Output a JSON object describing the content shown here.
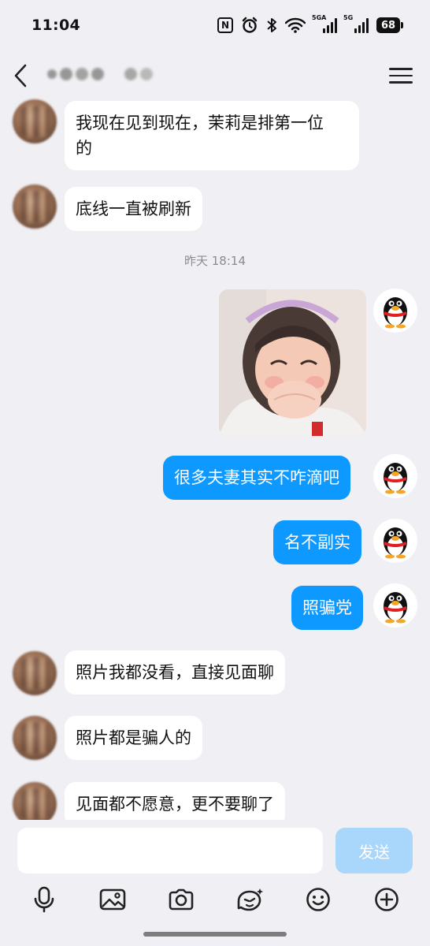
{
  "status_bar": {
    "time": "11:04",
    "battery": "68",
    "signal_1_label": "5GA",
    "signal_2_label": "5G",
    "nfc_label": "N"
  },
  "header": {
    "contact_name_hidden": true
  },
  "messages": [
    {
      "id": "m1",
      "direction": "in",
      "text": "我现在见到现在，茉莉是排第一位\n的"
    },
    {
      "id": "m2",
      "direction": "in",
      "text": "底线一直被刷新"
    },
    {
      "id": "ts1",
      "type": "timestamp",
      "text": "昨天 18:14"
    },
    {
      "id": "m3",
      "direction": "out",
      "type": "sticker",
      "description": "laughing child sticker"
    },
    {
      "id": "m4",
      "direction": "out",
      "text": "很多夫妻其实不咋滴吧"
    },
    {
      "id": "m5",
      "direction": "out",
      "text": "名不副实"
    },
    {
      "id": "m6",
      "direction": "out",
      "text": "照骗党"
    },
    {
      "id": "m7",
      "direction": "in",
      "text": "照片我都没看，直接见面聊"
    },
    {
      "id": "m8",
      "direction": "in",
      "text": "照片都是骗人的"
    },
    {
      "id": "m9",
      "direction": "in",
      "text": "见面都不愿意，更不要聊了"
    }
  ],
  "input": {
    "value": "",
    "placeholder": "",
    "send_label": "发送"
  },
  "toolbar": {
    "items": [
      "microphone-icon",
      "image-icon",
      "camera-icon",
      "magic-emoji-icon",
      "smiley-icon",
      "plus-icon"
    ]
  },
  "colors": {
    "background": "#f0eff3",
    "outgoing_bubble": "#0d99ff",
    "incoming_bubble": "#ffffff",
    "send_button_disabled": "#a9d6fb",
    "timestamp": "#8c8c8c"
  }
}
